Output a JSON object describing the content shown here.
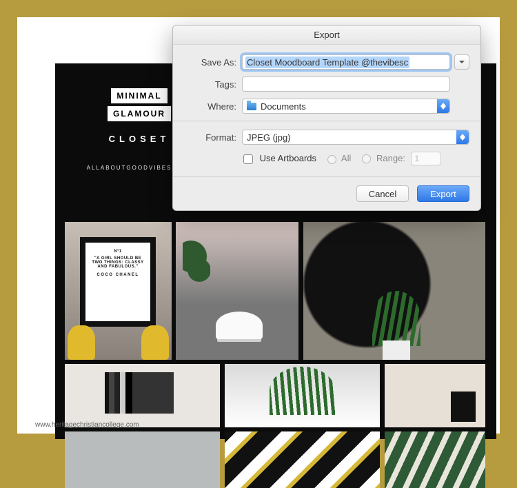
{
  "dialog": {
    "title": "Export",
    "save_as_label": "Save As:",
    "save_as_value": "Closet Moodboard Template @thevibesc",
    "tags_label": "Tags:",
    "tags_value": "",
    "where_label": "Where:",
    "where_value": "Documents",
    "format_label": "Format:",
    "format_value": "JPEG (jpg)",
    "use_artboards_label": "Use Artboards",
    "all_label": "All",
    "range_label": "Range:",
    "range_value": "1",
    "cancel_label": "Cancel",
    "export_label": "Export"
  },
  "moodboard": {
    "title_line1": "MINIMAL",
    "title_line2": "GLAMOUR",
    "subtitle": "CLOSET",
    "site": "ALLABOUTGOODVIBES.COM",
    "frame_no": "N°1",
    "quote": "\"A GIRL SHOULD BE TWO THINGS: CLASSY AND FABULOUS.\"",
    "quote_author": "COCO CHANEL"
  },
  "watermark": "www.heritagechristiancollege.com"
}
